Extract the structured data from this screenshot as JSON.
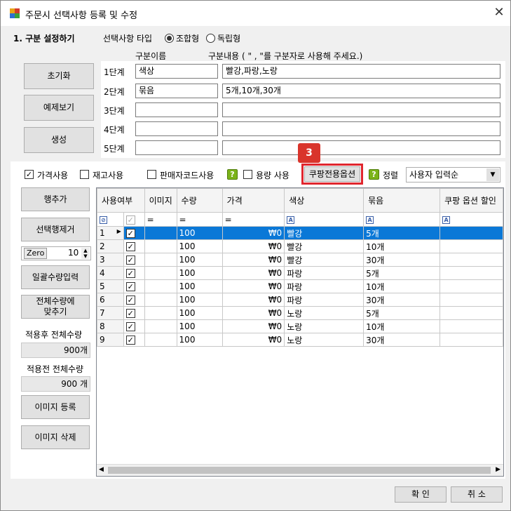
{
  "window": {
    "title": "주문시 선택사항 등록 및 수정",
    "close_label": "✕"
  },
  "section1": {
    "heading": "1. 구분 설정하기",
    "option_type_label": "선택사항 타입",
    "radio_combined": "조합형",
    "radio_independent": "독립형"
  },
  "side_buttons": {
    "reset": "초기화",
    "preview": "예제보기",
    "generate": "생성"
  },
  "levels": {
    "col_name_header": "구분이름",
    "col_content_header": "구분내용 ( \" , \"를 구분자로 사용해 주세요.)",
    "rows": [
      {
        "label": "1단계",
        "name": "색상",
        "content": "빨강,파랑,노랑"
      },
      {
        "label": "2단계",
        "name": "묶음",
        "content": "5개,10개,30개"
      },
      {
        "label": "3단계",
        "name": "",
        "content": ""
      },
      {
        "label": "4단계",
        "name": "",
        "content": ""
      },
      {
        "label": "5단계",
        "name": "",
        "content": ""
      }
    ]
  },
  "options_bar": {
    "price_use": "가격사용",
    "stock_use": "재고사용",
    "seller_code_use": "판매자코드사용",
    "capacity_use": "용량 사용",
    "coupang_button": "쿠팡전용옵션",
    "badge": "3",
    "sort_label": "정렬",
    "sort_value": "사용자 입력순",
    "help_icon_label": "?"
  },
  "left_panel": {
    "add_row": "행추가",
    "delete_selected": "선택행제거",
    "zero_label": "Zero",
    "zero_value": "10",
    "bulk_qty": "일괄수량입력",
    "fit_total_line1": "전체수량에",
    "fit_total_line2": "맞추기",
    "after_total_label": "적용후 전체수량",
    "after_total_value": "900개",
    "before_total_label": "적용전 전체수량",
    "before_total_value": "900 개",
    "image_register": "이미지 등록",
    "image_delete": "이미지 삭제"
  },
  "grid": {
    "headers": [
      "사용여부",
      "이미지",
      "수량",
      "가격",
      "색상",
      "묶음",
      "쿠팡 옵션 할인"
    ],
    "filter_ops": [
      "=",
      "=",
      "="
    ],
    "rows": [
      {
        "no": "1",
        "qty": "100",
        "price": "₩0",
        "color": "빨강",
        "bundle": "5개"
      },
      {
        "no": "2",
        "qty": "100",
        "price": "₩0",
        "color": "빨강",
        "bundle": "10개"
      },
      {
        "no": "3",
        "qty": "100",
        "price": "₩0",
        "color": "빨강",
        "bundle": "30개"
      },
      {
        "no": "4",
        "qty": "100",
        "price": "₩0",
        "color": "파랑",
        "bundle": "5개"
      },
      {
        "no": "5",
        "qty": "100",
        "price": "₩0",
        "color": "파랑",
        "bundle": "10개"
      },
      {
        "no": "6",
        "qty": "100",
        "price": "₩0",
        "color": "파랑",
        "bundle": "30개"
      },
      {
        "no": "7",
        "qty": "100",
        "price": "₩0",
        "color": "노랑",
        "bundle": "5개"
      },
      {
        "no": "8",
        "qty": "100",
        "price": "₩0",
        "color": "노랑",
        "bundle": "10개"
      },
      {
        "no": "9",
        "qty": "100",
        "price": "₩0",
        "color": "노랑",
        "bundle": "30개"
      }
    ]
  },
  "footer": {
    "ok": "확 인",
    "cancel": "취 소"
  },
  "colors": {
    "selection": "#0a78d7",
    "highlight_border": "#e0262e",
    "badge": "#d9342b"
  }
}
